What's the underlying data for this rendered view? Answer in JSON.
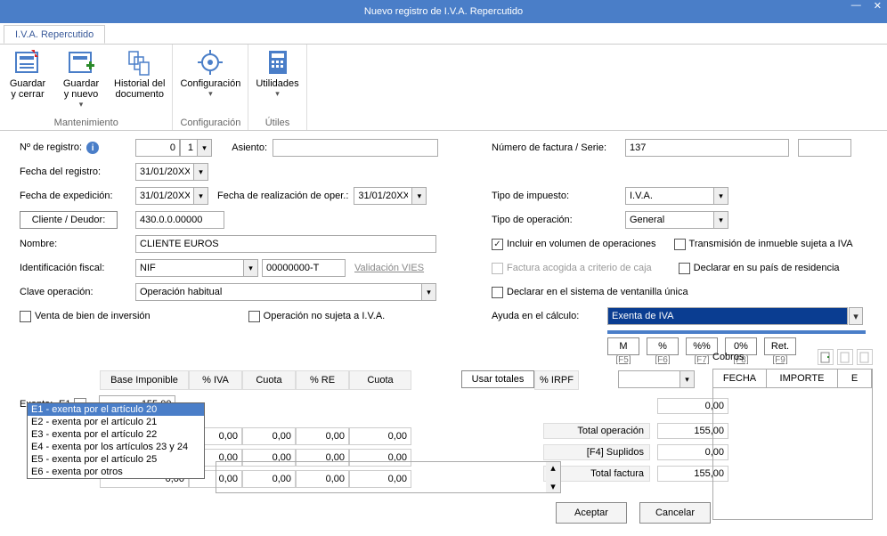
{
  "window": {
    "title": "Nuevo registro de I.V.A. Repercutido"
  },
  "tab": {
    "label": "I.V.A. Repercutido"
  },
  "ribbon": {
    "save_close": "Guardar\ny cerrar",
    "save_new": "Guardar\ny nuevo",
    "history": "Historial del\ndocumento",
    "config": "Configuración",
    "utils": "Utilidades",
    "group_maint": "Mantenimiento",
    "group_config": "Configuración",
    "group_utils": "Útiles"
  },
  "left": {
    "reg_no_label": "Nº de registro:",
    "reg_no_a": "0",
    "reg_no_b": "1",
    "asiento_label": "Asiento:",
    "fecha_reg_label": "Fecha del registro:",
    "fecha_reg": "31/01/20XX",
    "fecha_exp_label": "Fecha de expedición:",
    "fecha_exp": "31/01/20XX",
    "fecha_oper_label": "Fecha de realización de oper.:",
    "fecha_oper": "31/01/20XX",
    "cliente_btn": "Cliente / Deudor:",
    "cliente_val": "430.0.0.00000",
    "nombre_label": "Nombre:",
    "nombre_val": "CLIENTE EUROS",
    "ident_label": "Identificación fiscal:",
    "ident_type": "NIF",
    "ident_val": "00000000-T",
    "valid_vies": "Validación VIES",
    "clave_label": "Clave operación:",
    "clave_val": "Operación habitual",
    "venta_bien": "Venta de bien de inversión",
    "no_sujeta": "Operación no sujeta a I.V.A."
  },
  "right": {
    "num_fact_label": "Número de factura / Serie:",
    "num_fact_val": "137",
    "tipo_imp_label": "Tipo de impuesto:",
    "tipo_imp_val": "I.V.A.",
    "tipo_oper_label": "Tipo de operación:",
    "tipo_oper_val": "General",
    "incluir": "Incluir en volumen de operaciones",
    "transmision": "Transmisión de inmueble sujeta a IVA",
    "factura_caja": "Factura acogida a criterio de caja",
    "declarar_pais": "Declarar en su país de residencia",
    "declarar_vent": "Declarar en el sistema de ventanilla única",
    "ayuda_label": "Ayuda en el cálculo:",
    "ayuda_val": "Exenta de IVA",
    "macros": {
      "m": "M",
      "pct": "%",
      "pctpct": "%%",
      "zero": "0%",
      "ret": "Ret.",
      "f5": "[F5]",
      "f6": "[F6]",
      "f7": "[F7]",
      "f8": "[F8]",
      "f9": "[F9]"
    }
  },
  "grid": {
    "h_base": "Base Imponible",
    "h_iva": "% IVA",
    "h_cuota": "Cuota",
    "h_re": "% RE",
    "h_cuota2": "Cuota",
    "h_usar": "Usar totales",
    "h_irpf": "% IRPF",
    "exenta_label": "Exenta:",
    "exenta_code": "E1",
    "exenta_val": "155,00",
    "zero": "0,00",
    "dropdown": [
      "E1 - exenta por el artículo 20",
      "E2 - exenta por el artículo 21",
      "E3 - exenta por el artículo 22",
      "E4 - exenta por los artículos 23 y 24",
      "E5 - exenta por el artículo 25",
      "E6 - exenta por otros"
    ]
  },
  "totals": {
    "tot_oper_label": "Total operación",
    "tot_oper_val": "155,00",
    "suplidos_label": "[F4] Suplidos",
    "suplidos_val": "0,00",
    "tot_fact_label": "Total factura",
    "tot_fact_val": "155,00",
    "pre_val": "0,00"
  },
  "cobros": {
    "title": "Cobros",
    "col_fecha": "FECHA",
    "col_importe": "IMPORTE",
    "col_e": "E"
  },
  "buttons": {
    "accept": "Aceptar",
    "cancel": "Cancelar"
  }
}
